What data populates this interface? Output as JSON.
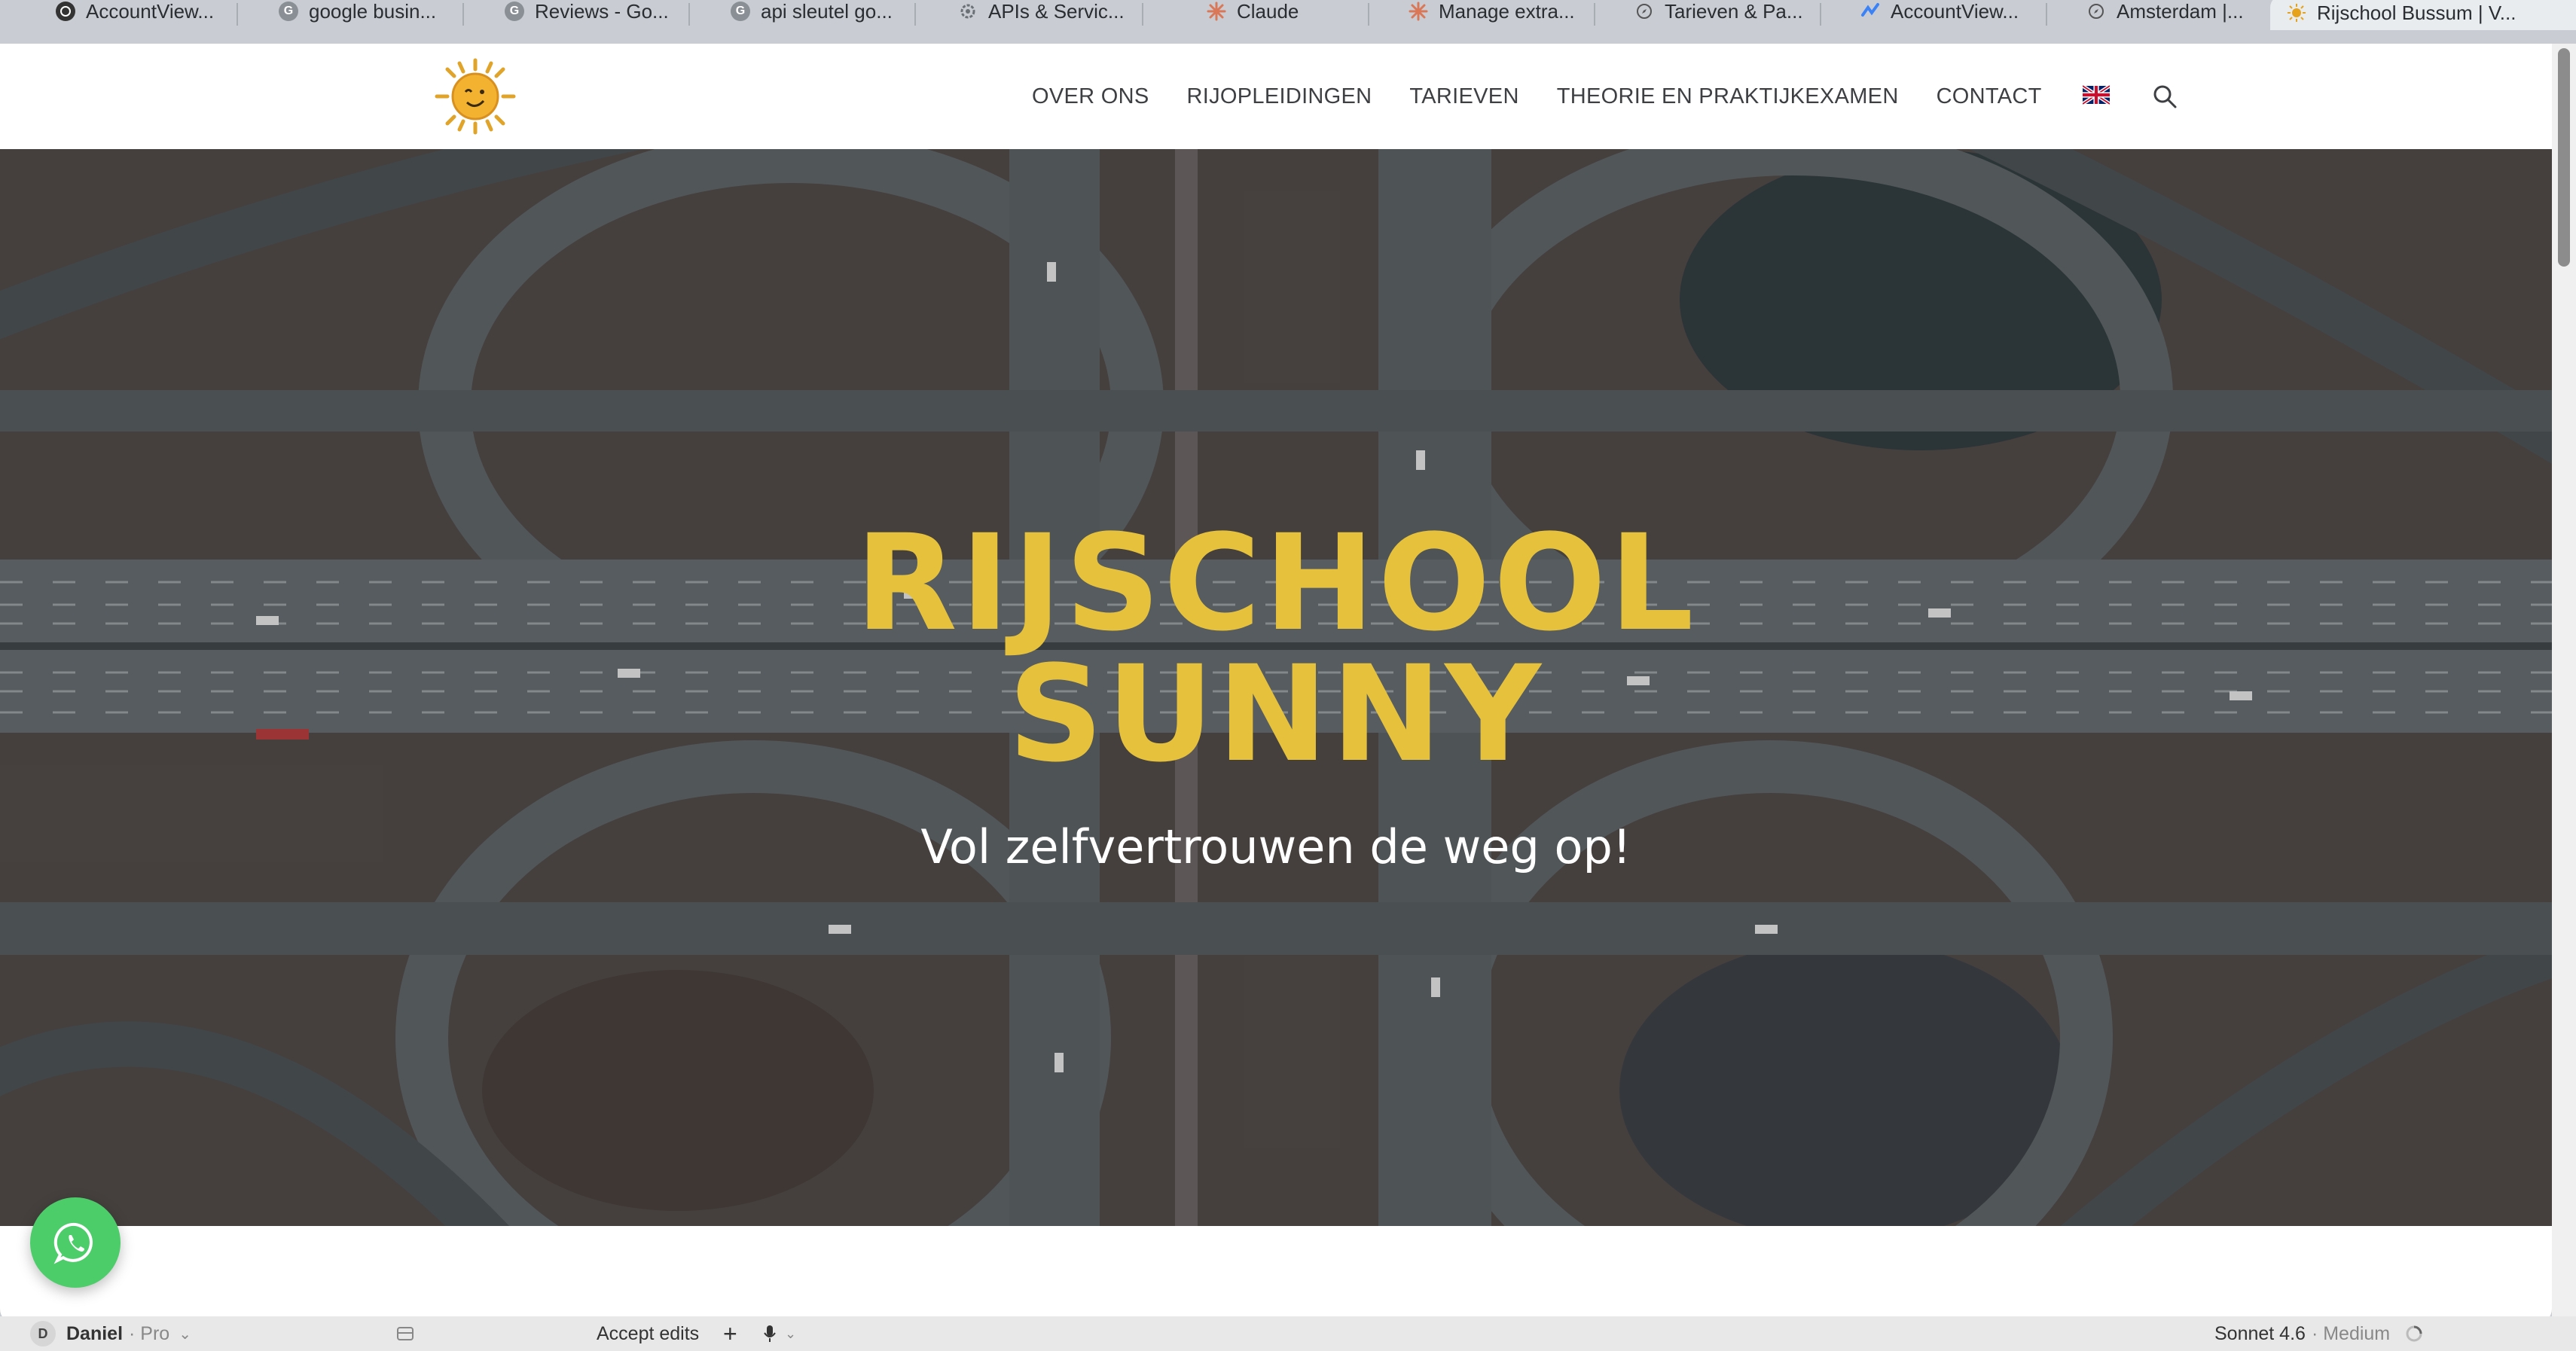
{
  "browser": {
    "tabs": [
      {
        "label": "AccountView...",
        "icon": "openai-icon",
        "color": "#333333"
      },
      {
        "label": "google busin...",
        "icon": "google-icon",
        "color": "#8a8f96"
      },
      {
        "label": "Reviews - Go...",
        "icon": "google-icon",
        "color": "#8a8f96"
      },
      {
        "label": "api sleutel go...",
        "icon": "google-icon",
        "color": "#8a8f96"
      },
      {
        "label": "APIs & Servic...",
        "icon": "gear-icon",
        "color": "#8a8f96"
      },
      {
        "label": "Claude",
        "icon": "claude-icon",
        "color": "#d97757"
      },
      {
        "label": "Manage extra...",
        "icon": "claude-icon",
        "color": "#d97757"
      },
      {
        "label": "Tarieven & Pa...",
        "icon": "compass-icon",
        "color": "#8a8f96"
      },
      {
        "label": "AccountView...",
        "icon": "accountview-icon",
        "color": "#3b82f6"
      },
      {
        "label": "Amsterdam |...",
        "icon": "compass-icon",
        "color": "#8a8f96"
      },
      {
        "label": "Rijschool Bussum | V...",
        "icon": "sun-icon",
        "color": "#e6a21b"
      }
    ]
  },
  "site": {
    "nav": [
      "OVER ONS",
      "RIJOPLEIDINGEN",
      "TARIEVEN",
      "THEORIE EN PRAKTIJKEXAMEN",
      "CONTACT"
    ],
    "hero": {
      "title_line1": "RIJSCHOOL",
      "title_line2": "SUNNY",
      "subtitle": "Vol zelfvertrouwen de weg op!"
    },
    "colors": {
      "accent": "#e6c13b",
      "whatsapp": "#4ccd6a"
    }
  },
  "app_bar": {
    "user_initial": "D",
    "user_name": "Daniel",
    "user_plan": "· Pro",
    "accept_edits": "Accept edits",
    "model": "Sonnet 4.6",
    "effort": "· Medium"
  }
}
